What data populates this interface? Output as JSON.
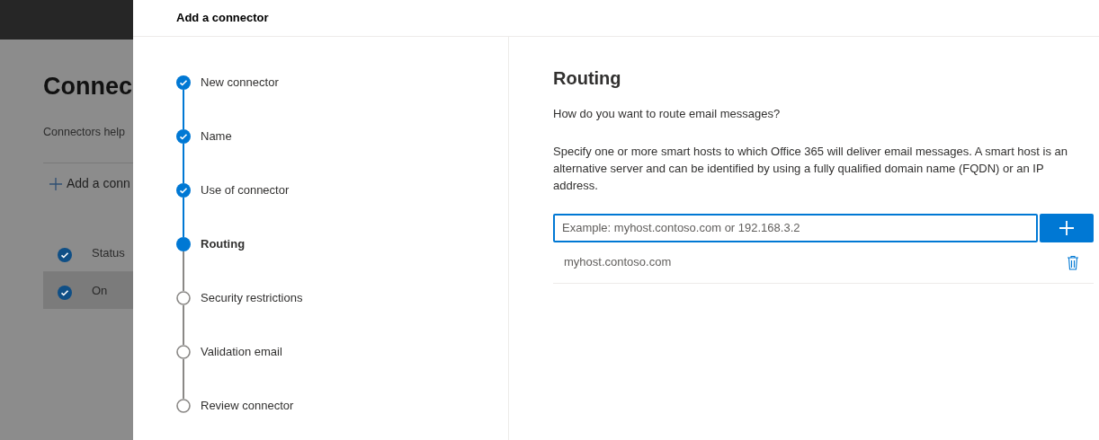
{
  "background_page": {
    "title": "Connec",
    "description": "Connectors help",
    "add_button": "Add a conn",
    "table": {
      "header": {
        "label": "Status",
        "checked": true
      },
      "rows": [
        {
          "cell": "On",
          "checked": true,
          "selected": true
        }
      ]
    }
  },
  "panel": {
    "title": "Add a connector",
    "steps": [
      {
        "label": "New connector",
        "completed": true,
        "selected": false
      },
      {
        "label": "Name",
        "completed": true,
        "selected": false
      },
      {
        "label": "Use of connector",
        "completed": true,
        "selected": false
      },
      {
        "label": "Routing",
        "completed": false,
        "selected": true
      },
      {
        "label": "Security restrictions",
        "completed": false,
        "selected": false
      },
      {
        "label": "Validation email",
        "completed": false,
        "selected": false
      },
      {
        "label": "Review connector",
        "completed": false,
        "selected": false
      }
    ],
    "section": {
      "heading": "Routing",
      "question": "How do you want to route email messages?",
      "instructions": "Specify one or more smart hosts to which Office 365 will deliver email messages. A smart host is an alternative server and can be identified by using a fully qualified domain name (FQDN) or an IP address.",
      "host_field": {
        "placeholder": "Example: myhost.contoso.com or 192.168.3.2"
      },
      "hosts": [
        "myhost.contoso.com"
      ]
    }
  }
}
